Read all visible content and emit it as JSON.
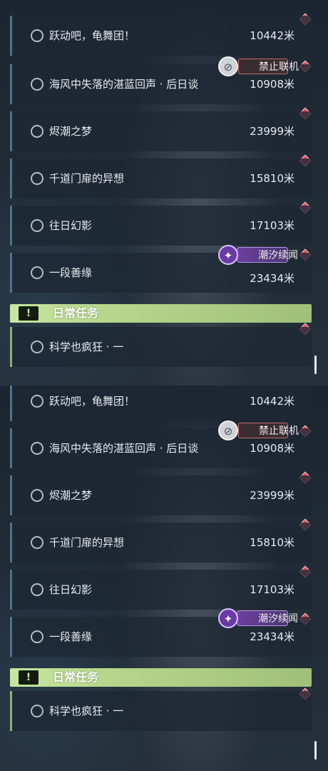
{
  "screen_a": {
    "quests": [
      {
        "title": "跃动吧，龟舞团！",
        "distance": "10442米"
      },
      {
        "title": "海风中失落的湛蓝回声 · 后日谈",
        "distance": "10908米",
        "badge": "禁止联机"
      },
      {
        "title": "烬潮之梦",
        "distance": "23999米"
      },
      {
        "title": "千道门扉的异想",
        "distance": "15810米"
      },
      {
        "title": "往日幻影",
        "distance": "17103米"
      },
      {
        "title": "一段善缘",
        "distance": "23434米",
        "badge": "潮汐续闻"
      }
    ],
    "section_title": "日常任务",
    "daily_quest": {
      "title": "科学也疯狂 · 一"
    }
  },
  "screen_b": {
    "quests": [
      {
        "title": "跃动吧，龟舞团！",
        "distance": "10442米"
      },
      {
        "title": "海风中失落的湛蓝回声 · 后日谈",
        "distance": "10908米",
        "badge": "禁止联机"
      },
      {
        "title": "烬潮之梦",
        "distance": "23999米"
      },
      {
        "title": "千道门扉的异想",
        "distance": "15810米"
      },
      {
        "title": "往日幻影",
        "distance": "17103米"
      },
      {
        "title": "一段善缘",
        "distance": "23434米",
        "badge": "潮汐续闻"
      }
    ],
    "section_title": "日常任务",
    "daily_quest": {
      "title": "科学也疯狂 · 一"
    }
  },
  "icons": {
    "radio": "radio-circle-icon",
    "marker": "red-diamond-marker-icon",
    "ban": "no-coop-icon",
    "tide": "tide-sparkle-icon",
    "warn": "exclamation-icon"
  },
  "colors": {
    "row_bg": "#1e2834",
    "row_accent": "#4f7388",
    "daily_accent": "#8fb36a",
    "section_green": "#b7d88c",
    "marker_red": "#e0505a",
    "ban_border": "#c56a6a",
    "tide_purple": "#6c3fa0"
  }
}
